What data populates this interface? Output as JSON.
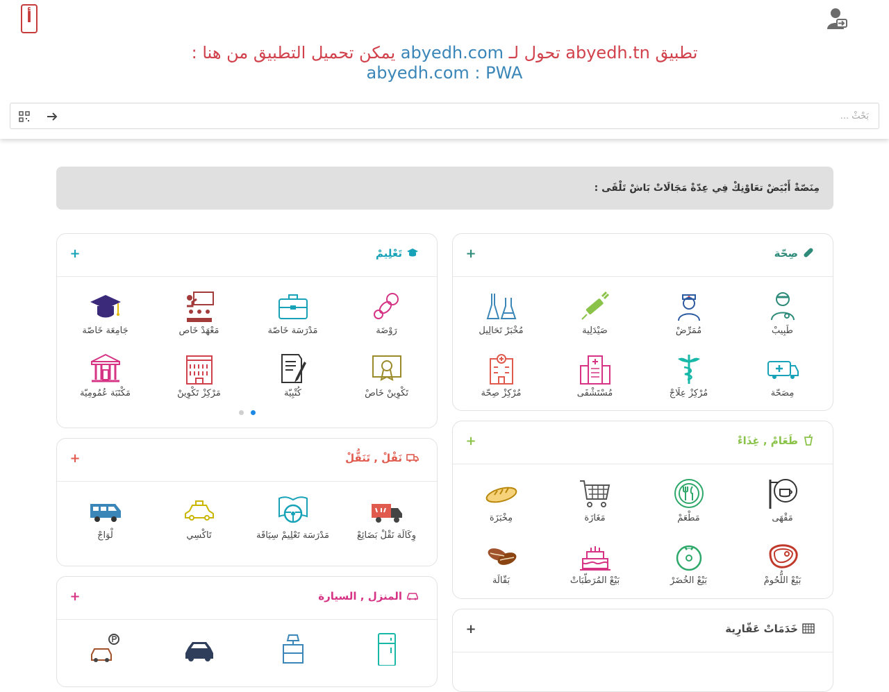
{
  "header": {
    "logo_text": "أ",
    "banner": {
      "part1": "تطبيق abyedh.tn تحول لـ",
      "link1": "abyedh.com",
      "part2": "يمكن تحميل التطبيق من هنا :",
      "line2": "abyedh.com : PWA"
    },
    "search": {
      "placeholder": "بَحْثْ ..."
    }
  },
  "intro": {
    "text": "مِنَصّةْ أَبْيَضْ تعَاوْنِكْ فِي عِدّةْ مَجَالَاتْ بَاشْ تَلْقَى :"
  },
  "colors": {
    "health": "#2e8b7a",
    "education": "#17a2b8",
    "food": "#8bc34a",
    "transport": "#e05a4e",
    "home": "#d63384",
    "realestate": "#444444"
  },
  "cards": {
    "health": {
      "title": "صِحّة",
      "icon": "pill-icon",
      "items": [
        {
          "label": "طَبِيبْ",
          "icon": "doctor-icon"
        },
        {
          "label": "مُمَرِّضْ",
          "icon": "nurse-icon"
        },
        {
          "label": "صَيْدَلِية",
          "icon": "syringe-icon"
        },
        {
          "label": "مُخْبَرْ تَحَالِيل",
          "icon": "lab-flask-icon"
        },
        {
          "label": "مِصَحّة",
          "icon": "ambulance-icon"
        },
        {
          "label": "مُرْكِزْ عِلَاجْ",
          "icon": "caduceus-icon"
        },
        {
          "label": "مُسْتَشْفَى",
          "icon": "hospital-icon"
        },
        {
          "label": "مُرْكِزْ صِحّة",
          "icon": "health-center-icon"
        }
      ]
    },
    "education": {
      "title": "تَعْلِيمْ",
      "icon": "graduation-cap-icon",
      "items": [
        {
          "label": "رَوْضَة",
          "icon": "pacifier-icon"
        },
        {
          "label": "مَدْرَسَة خَاصّة",
          "icon": "school-bag-icon"
        },
        {
          "label": "مَعْهَدْ خَاص",
          "icon": "classroom-icon"
        },
        {
          "label": "جَامِعَة خَاصّة",
          "icon": "mortarboard-icon"
        },
        {
          "label": "تَكْوِينْ خَاصْ",
          "icon": "certificate-icon"
        },
        {
          "label": "كُتْبِيّة",
          "icon": "notebook-pen-icon"
        },
        {
          "label": "مَرْكِزْ تَكْوِينْ",
          "icon": "training-building-icon"
        },
        {
          "label": "مَكْتَبَة عُمُومِيّة",
          "icon": "library-icon"
        }
      ]
    },
    "food": {
      "title": "طَعَامْ , غِذَاءْ",
      "icon": "cup-icon",
      "items": [
        {
          "label": "مَقْهَى",
          "icon": "coffee-sign-icon"
        },
        {
          "label": "مَطْعَمْ",
          "icon": "restaurant-plate-icon"
        },
        {
          "label": "مَغَازَة",
          "icon": "shopping-cart-icon"
        },
        {
          "label": "مِخْبَزَة",
          "icon": "bread-icon"
        },
        {
          "label": "بَيْعْ اللُّحُومْ",
          "icon": "steak-icon"
        },
        {
          "label": "بَيْعْ الخُضَرْ",
          "icon": "tomato-icon"
        },
        {
          "label": "بَيْعْ المُرَطّبَاتْ",
          "icon": "cake-icon"
        },
        {
          "label": "بَقّالَة",
          "icon": "grocery-icon"
        }
      ]
    },
    "transport": {
      "title": "نَقْلْ , تَنَقُّلْ",
      "icon": "truck-icon",
      "items": [
        {
          "label": "وِكَالَة نَقْلْ بَضَائِعْ",
          "icon": "cargo-truck-icon"
        },
        {
          "label": "مَدْرَسَة تَعْلِيمْ سِيَاقَة",
          "icon": "steering-wheel-icon"
        },
        {
          "label": "تَاكْسِي",
          "icon": "taxi-icon"
        },
        {
          "label": "لْوَاجْ",
          "icon": "van-icon"
        }
      ]
    },
    "home": {
      "title": "المنزل , السيارة",
      "icon": "car-icon"
    },
    "realestate": {
      "title": "خَدَمَاتْ عَقّارِية",
      "icon": "building-grid-icon"
    }
  },
  "carousel": {
    "active_index": 0,
    "count": 2
  }
}
